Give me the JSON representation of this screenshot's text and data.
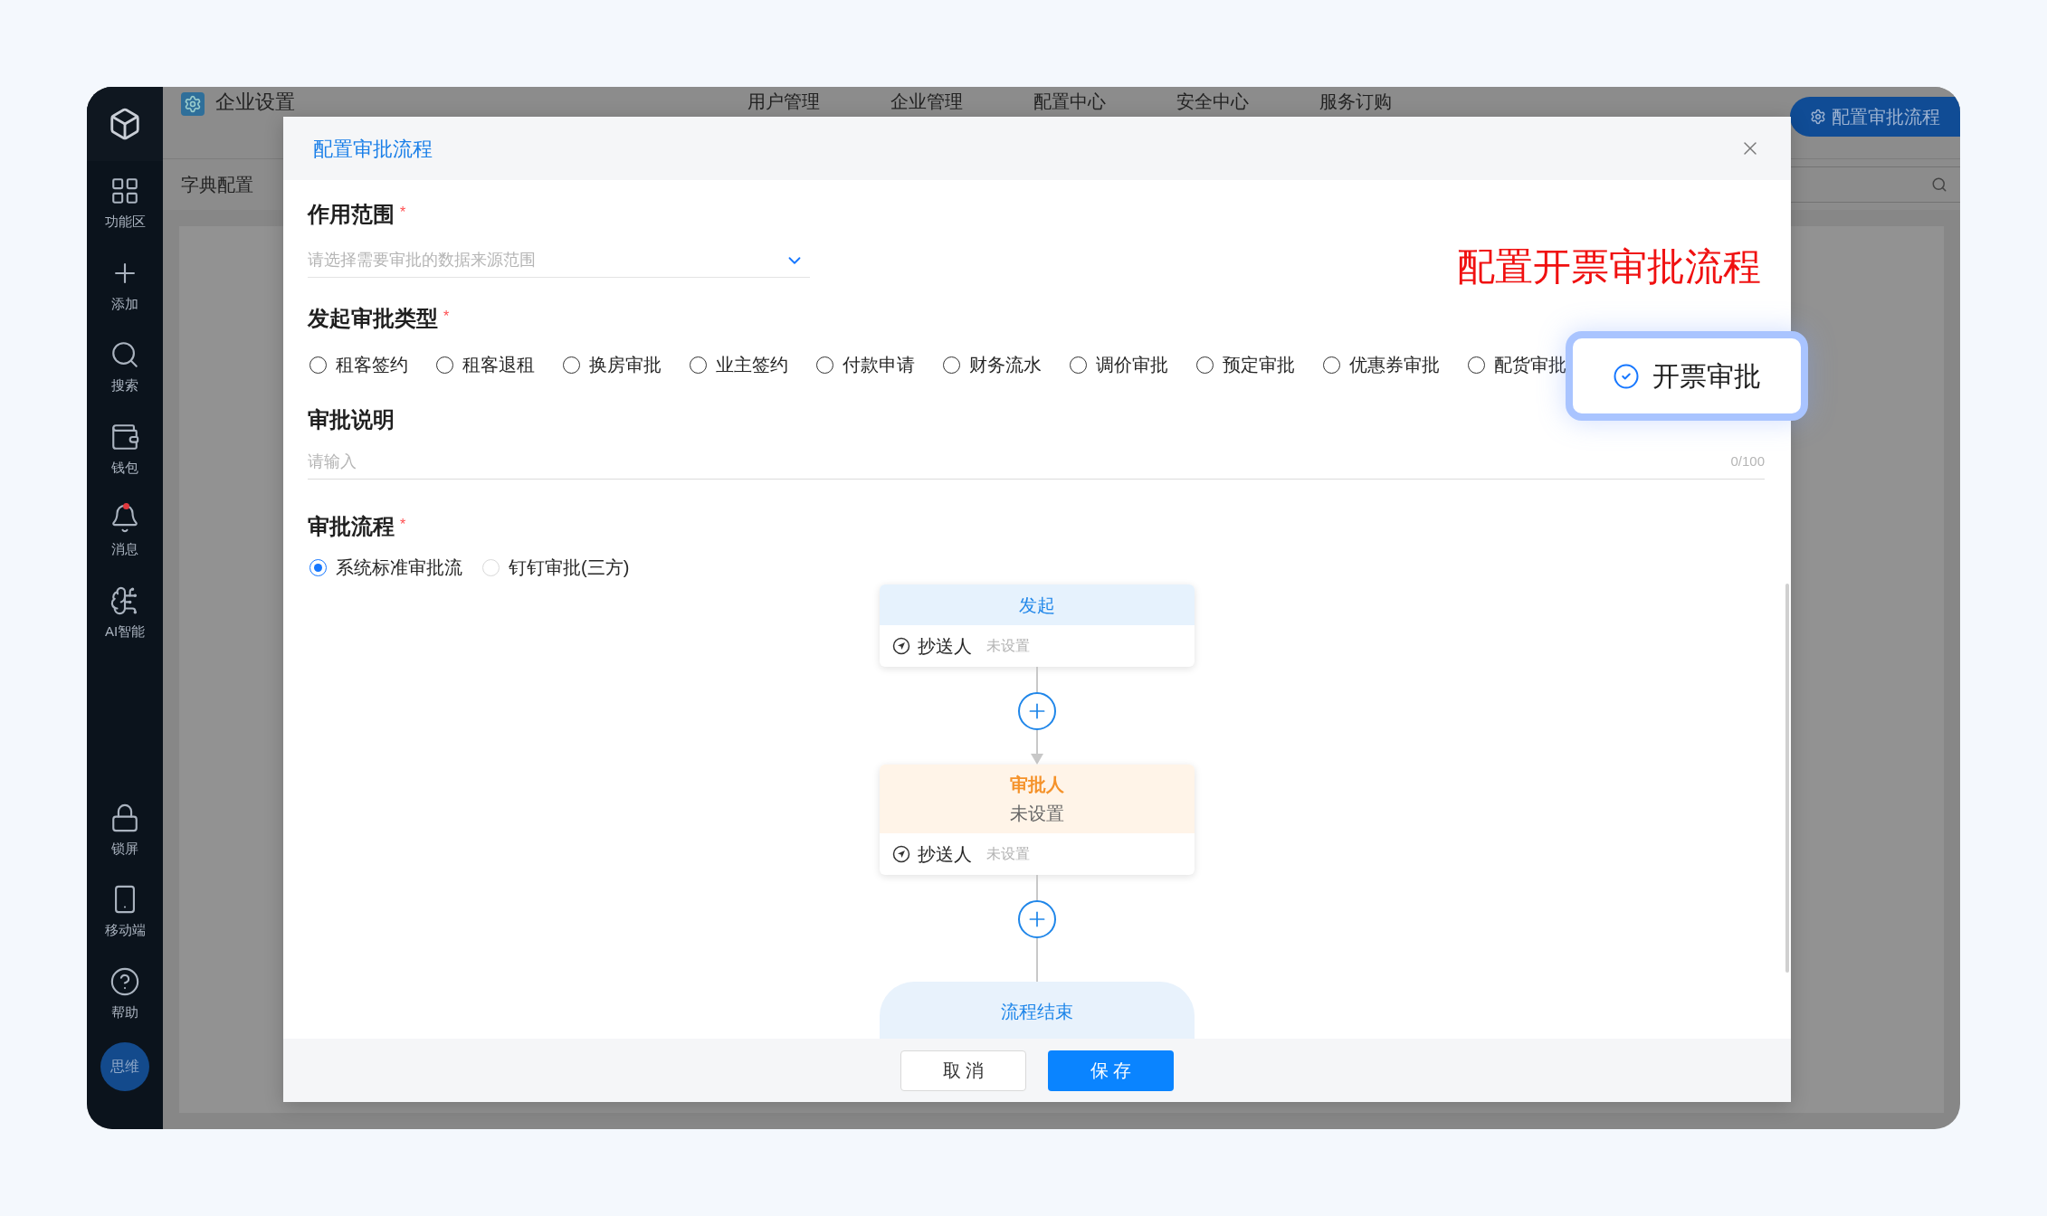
{
  "sidebar": {
    "items": [
      {
        "label": "功能区",
        "unread": false
      },
      {
        "label": "添加",
        "unread": false
      },
      {
        "label": "搜索",
        "unread": false
      },
      {
        "label": "钱包",
        "unread": false
      },
      {
        "label": "消息",
        "unread": true
      },
      {
        "label": "AI智能",
        "unread": false
      }
    ],
    "bottom_items": [
      {
        "label": "锁屏"
      },
      {
        "label": "移动端"
      },
      {
        "label": "帮助"
      }
    ],
    "avatar": "思维"
  },
  "header": {
    "title": "企业设置",
    "nav": [
      "用户管理",
      "企业管理",
      "配置中心",
      "安全中心",
      "服务订购"
    ],
    "action_button": "配置审批流程"
  },
  "subnav": [
    "字典配置"
  ],
  "dialog": {
    "title": "配置审批流程",
    "annotation": "配置开票审批流程",
    "scope": {
      "label": "作用范围",
      "mark": "*",
      "placeholder": "请选择需要审批的数据来源范围"
    },
    "types": {
      "label": "发起审批类型",
      "mark": "*",
      "options": [
        {
          "label": "租客签约",
          "selected": false
        },
        {
          "label": "租客退租",
          "selected": false
        },
        {
          "label": "换房审批",
          "selected": false
        },
        {
          "label": "业主签约",
          "selected": false
        },
        {
          "label": "付款申请",
          "selected": false
        },
        {
          "label": "财务流水",
          "selected": false
        },
        {
          "label": "调价审批",
          "selected": false
        },
        {
          "label": "预定审批",
          "selected": false
        },
        {
          "label": "优惠券审批",
          "selected": false
        },
        {
          "label": "配货审批",
          "selected": false
        }
      ]
    },
    "highlighted_option": {
      "label": "开票审批",
      "selected": true
    },
    "description": {
      "label": "审批说明",
      "placeholder": "请输入",
      "counter": "0/100"
    },
    "process": {
      "label": "审批流程",
      "mark": "*",
      "options": [
        {
          "label": "系统标准审批流",
          "selected": true
        },
        {
          "label": "钉钉审批(三方)",
          "selected": false
        }
      ]
    },
    "flow": [
      {
        "kind": "start",
        "title": "发起",
        "cc_label": "抄送人",
        "cc_value": "未设置"
      },
      {
        "kind": "approver",
        "title": "审批人",
        "subtitle": "未设置",
        "cc_label": "抄送人",
        "cc_value": "未设置"
      },
      {
        "kind": "end",
        "title": "流程结束"
      }
    ],
    "buttons": {
      "cancel": "取 消",
      "save": "保 存"
    }
  }
}
